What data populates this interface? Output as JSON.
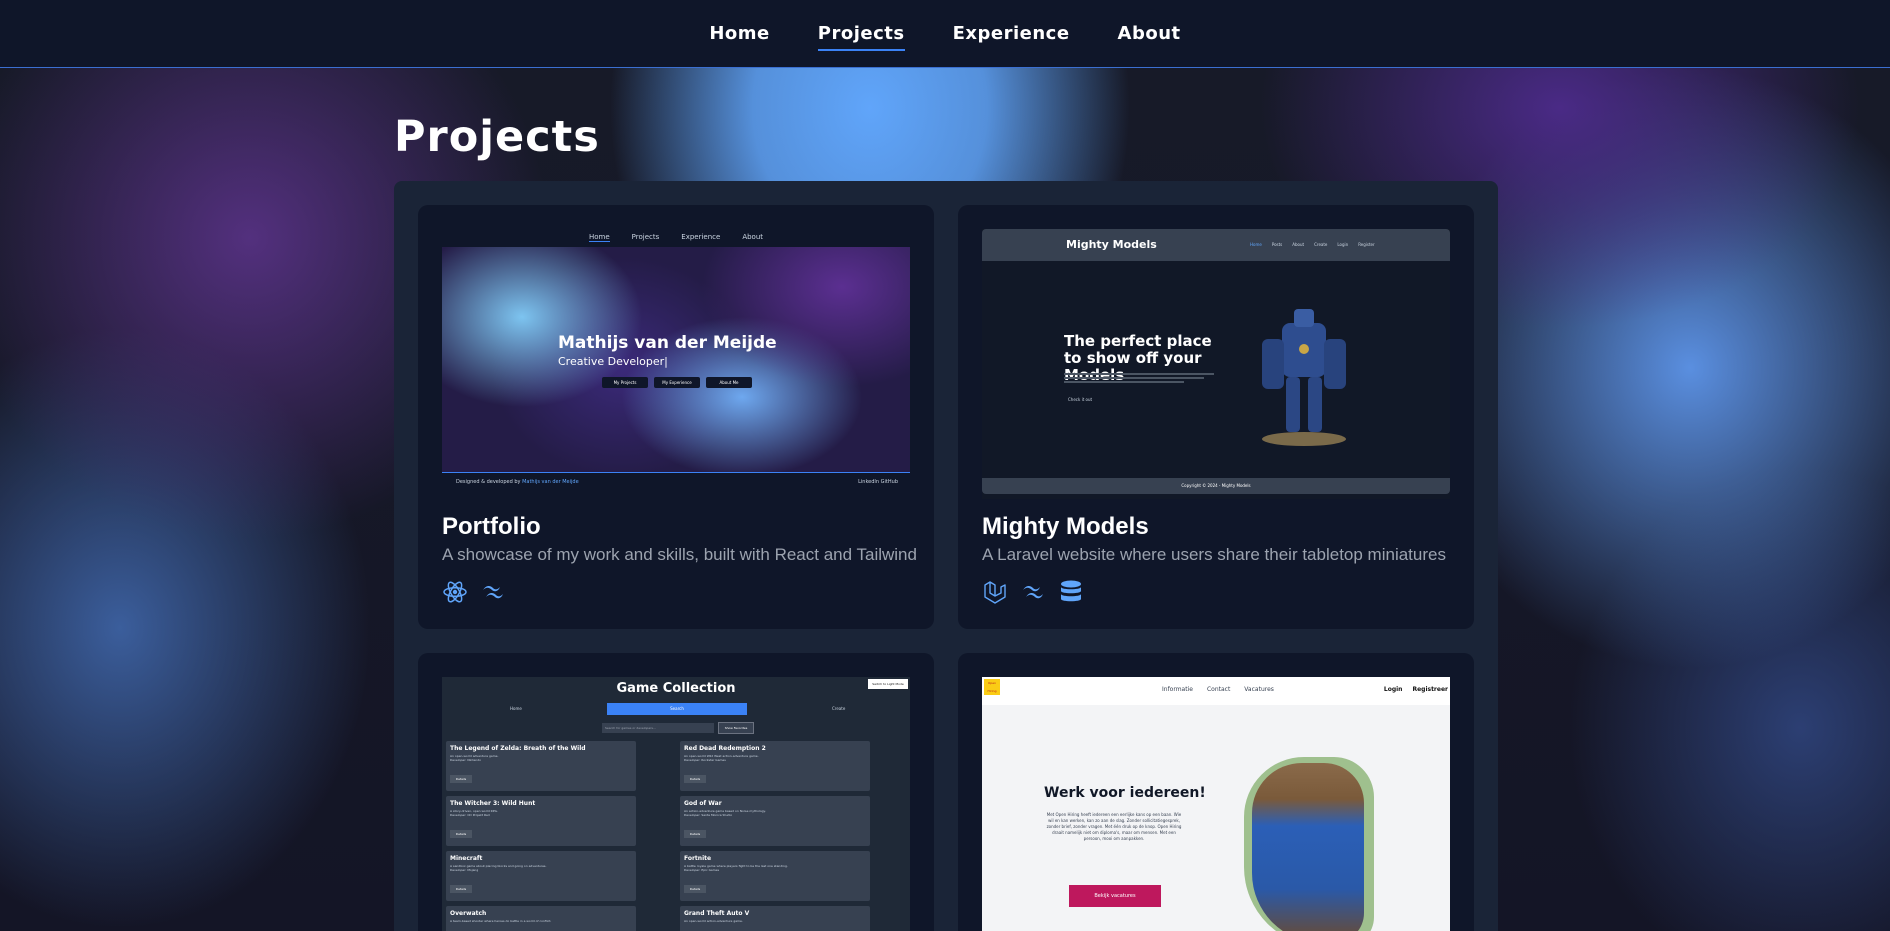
{
  "nav": {
    "items": [
      {
        "label": "Home",
        "active": false
      },
      {
        "label": "Projects",
        "active": true
      },
      {
        "label": "Experience",
        "active": false
      },
      {
        "label": "About",
        "active": false
      }
    ]
  },
  "page_title": "Projects",
  "colors": {
    "accent": "#3b82f6",
    "card_bg": "#0f1629",
    "panel_bg": "#1a2437",
    "muted": "#9ca3af"
  },
  "projects": [
    {
      "title": "Portfolio",
      "description": "A showcase of my work and skills, built with React and Tailwind",
      "tech_icons": [
        "react-icon",
        "tailwind-icon"
      ],
      "preview": {
        "nav": [
          "Home",
          "Projects",
          "Experience",
          "About"
        ],
        "name": "Mathijs van der Meijde",
        "subtitle": "Creative Developer|",
        "buttons": [
          "My Projects",
          "My Experience",
          "About Me"
        ],
        "footer_prefix": "Designed & developed by",
        "footer_name": "Mathijs van der Meijde",
        "footer_links": "LinkedIn   GitHub"
      }
    },
    {
      "title": "Mighty Models",
      "description": "A Laravel website where users share their tabletop miniatures",
      "tech_icons": [
        "laravel-icon",
        "tailwind-icon",
        "database-icon"
      ],
      "preview": {
        "logo": "Mighty Models",
        "links": [
          "Home",
          "Posts",
          "About",
          "Create",
          "Login",
          "Register"
        ],
        "headline": "The perfect place to show off your Models",
        "cta": "Check it out",
        "footer": "Copyright © 2024 - Mighty Models"
      }
    },
    {
      "preview": {
        "title": "Game Collection",
        "top_button": "Switch to Light Mode",
        "tabs": [
          "Home",
          "Search",
          "Create"
        ],
        "search_placeholder": "Search for games or developers...",
        "search_button": "Show Favorites",
        "games": [
          {
            "title": "The Legend of Zelda: Breath of the Wild",
            "desc": "An open-world adventure game.",
            "dev": "Developer: Nintendo"
          },
          {
            "title": "Red Dead Redemption 2",
            "desc": "An open-world Wild West action-adventure game.",
            "dev": "Developer: Rockstar Games"
          },
          {
            "title": "The Witcher 3: Wild Hunt",
            "desc": "A story-driven, open world RPG.",
            "dev": "Developer: CD Projekt Red"
          },
          {
            "title": "God of War",
            "desc": "An action-adventure game based on Norse mythology.",
            "dev": "Developer: Santa Monica Studio"
          },
          {
            "title": "Minecraft",
            "desc": "A sandbox game about placing blocks and going on adventures.",
            "dev": "Developer: Mojang"
          },
          {
            "title": "Fortnite",
            "desc": "A battle royale game where players fight to be the last one standing.",
            "dev": "Developer: Epic Games"
          },
          {
            "title": "Overwatch",
            "desc": "A team-based shooter where heroes do battle in a world of conflict.",
            "dev": ""
          },
          {
            "title": "Grand Theft Auto V",
            "desc": "An open-world action-adventure game.",
            "dev": ""
          }
        ],
        "details_label": "Details"
      }
    },
    {
      "preview": {
        "logo": "Open Hiring",
        "links": [
          "Informatie",
          "Contact",
          "Vacatures"
        ],
        "right_links": [
          "Login",
          "Registreer"
        ],
        "headline": "Werk voor iedereen!",
        "text": "Met Open Hiring heeft iedereen een eerlijke kans op een baan. Wie wil en kan werken, kan zo aan de slag. Zonder sollicitatiegesprek, zonder brief, zonder vragen. Met één druk op de knop. Open Hiring draait namelijk niet om diploma's, maar om mensen. Met een persoon, mooi om aanpakken.",
        "button": "Bekijk vacatures"
      }
    }
  ]
}
